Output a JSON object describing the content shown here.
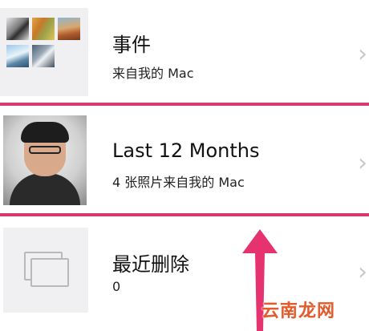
{
  "albums": [
    {
      "title": "事件",
      "subtitle": "来自我的 Mac"
    },
    {
      "title": "Last 12 Months",
      "subtitle": "4 张照片来自我的 Mac"
    },
    {
      "title": "最近删除",
      "subtitle": "0"
    }
  ],
  "chevron": "›",
  "watermark": "云南龙网",
  "colors": {
    "highlight": "#d93a6e",
    "arrow": "#e6336f"
  }
}
